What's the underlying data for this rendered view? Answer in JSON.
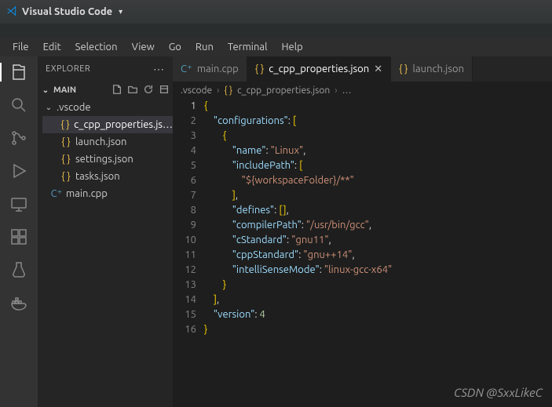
{
  "titlebar": {
    "app_name": "Visual Studio Code"
  },
  "menubar": {
    "items": [
      "File",
      "Edit",
      "Selection",
      "View",
      "Go",
      "Run",
      "Terminal",
      "Help"
    ]
  },
  "activitybar": {
    "icons": [
      "explorer",
      "search",
      "scm",
      "run-debug",
      "remote",
      "extensions",
      "testing",
      "docker"
    ],
    "active_index": 0
  },
  "sidebar": {
    "title": "EXPLORER",
    "section": "MAIN",
    "folder": {
      "name": ".vscode",
      "files": [
        {
          "name": "c_cpp_properties.js…",
          "icon": "json",
          "active": true
        },
        {
          "name": "launch.json",
          "icon": "json",
          "active": false
        },
        {
          "name": "settings.json",
          "icon": "json",
          "active": false
        },
        {
          "name": "tasks.json",
          "icon": "json",
          "active": false
        }
      ]
    },
    "root_files": [
      {
        "name": "main.cpp",
        "icon": "cpp"
      }
    ]
  },
  "tabs": [
    {
      "label": "main.cpp",
      "icon": "cpp",
      "active": false,
      "close": false
    },
    {
      "label": "c_cpp_properties.json",
      "icon": "json",
      "active": true,
      "close": true
    },
    {
      "label": "launch.json",
      "icon": "json",
      "active": false,
      "close": false
    }
  ],
  "breadcrumb": {
    "parts": [
      ".vscode",
      "c_cpp_properties.json"
    ],
    "trailing_icon": "json"
  },
  "editor": {
    "current_line": 1,
    "line_count": 16,
    "lines_html": [
      "<span class='b'>{</span>",
      "    <span class='k'>\"configurations\"</span><span class='p'>:</span> <span class='b'>[</span>",
      "        <span class='b'>{</span>",
      "            <span class='k'>\"name\"</span><span class='p'>:</span> <span class='s'>\"Linux\"</span><span class='p'>,</span>",
      "            <span class='k'>\"includePath\"</span><span class='p'>:</span> <span class='b'>[</span>",
      "                <span class='s'>\"${workspaceFolder}/**\"</span>",
      "            <span class='b'>]</span><span class='p'>,</span>",
      "            <span class='k'>\"defines\"</span><span class='p'>:</span> <span class='b'>[]</span><span class='p'>,</span>",
      "            <span class='k'>\"compilerPath\"</span><span class='p'>:</span> <span class='s'>\"/usr/bin/gcc\"</span><span class='p'>,</span>",
      "            <span class='k'>\"cStandard\"</span><span class='p'>:</span> <span class='s'>\"gnu11\"</span><span class='p'>,</span>",
      "            <span class='k'>\"cppStandard\"</span><span class='p'>:</span> <span class='s'>\"gnu++14\"</span><span class='p'>,</span>",
      "            <span class='k'>\"intelliSenseMode\"</span><span class='p'>:</span> <span class='s'>\"linux-gcc-x64\"</span>",
      "        <span class='b'>}</span>",
      "    <span class='b'>]</span><span class='p'>,</span>",
      "    <span class='k'>\"version\"</span><span class='p'>:</span> <span class='n'>4</span>",
      "<span class='b'>}</span>"
    ]
  },
  "watermark": "CSDN @SxxLikeC"
}
